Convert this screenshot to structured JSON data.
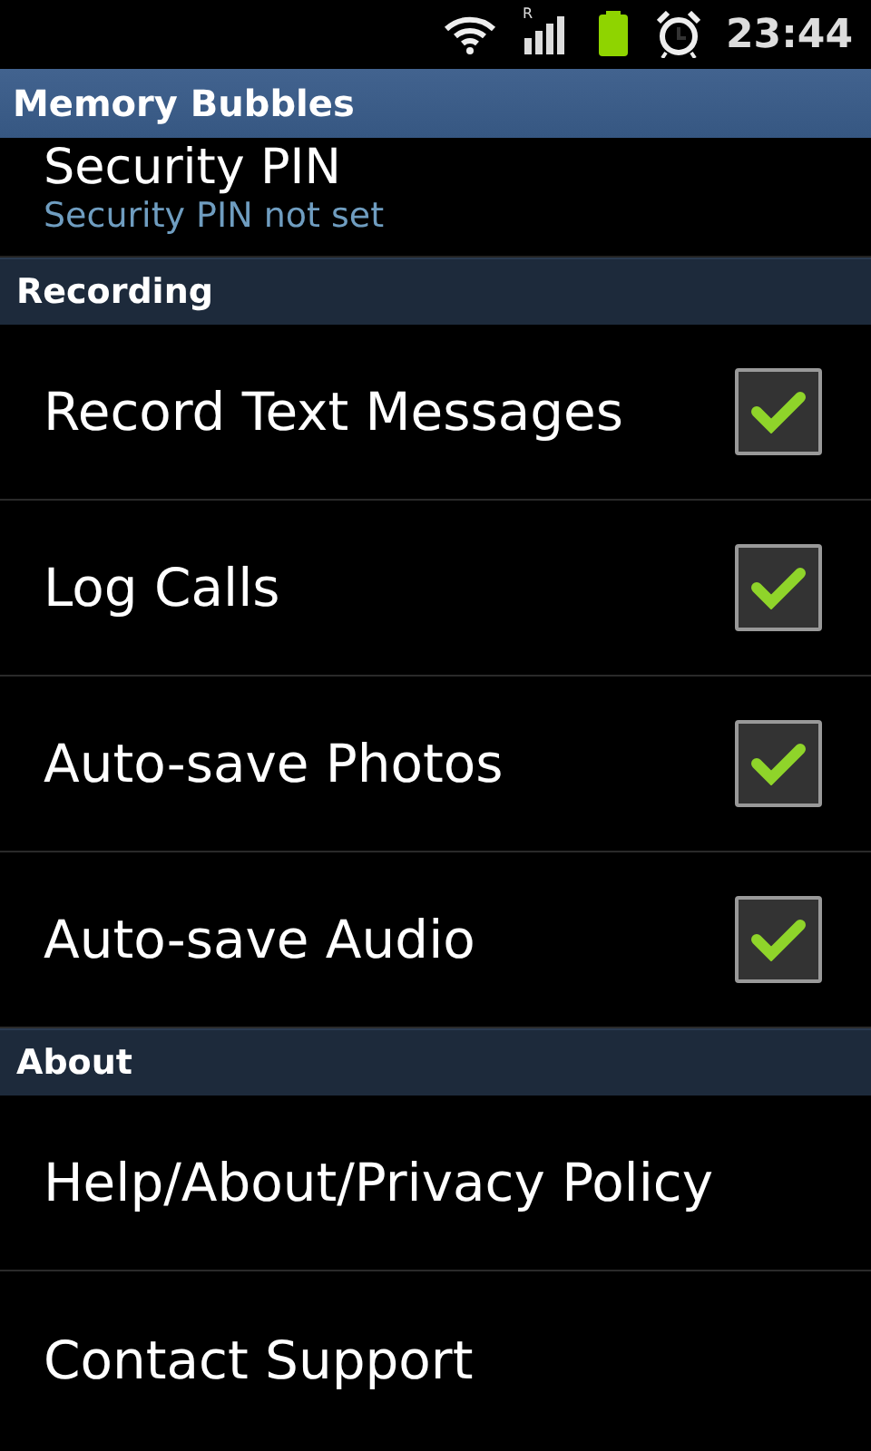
{
  "status_bar": {
    "roaming_indicator": "R",
    "time": "23:44"
  },
  "title_bar": {
    "title": "Memory Bubbles"
  },
  "preferences": [
    {
      "kind": "item",
      "title": "Security PIN",
      "summary": "Security PIN not set"
    },
    {
      "kind": "category",
      "title": "Recording"
    },
    {
      "kind": "checkbox",
      "title": "Record Text Messages",
      "checked": true
    },
    {
      "kind": "checkbox",
      "title": "Log Calls",
      "checked": true
    },
    {
      "kind": "checkbox",
      "title": "Auto-save Photos",
      "checked": true
    },
    {
      "kind": "checkbox",
      "title": "Auto-save Audio",
      "checked": true
    },
    {
      "kind": "category",
      "title": "About"
    },
    {
      "kind": "link",
      "title": "Help/About/Privacy Policy"
    },
    {
      "kind": "link",
      "title": "Contact Support"
    }
  ]
}
